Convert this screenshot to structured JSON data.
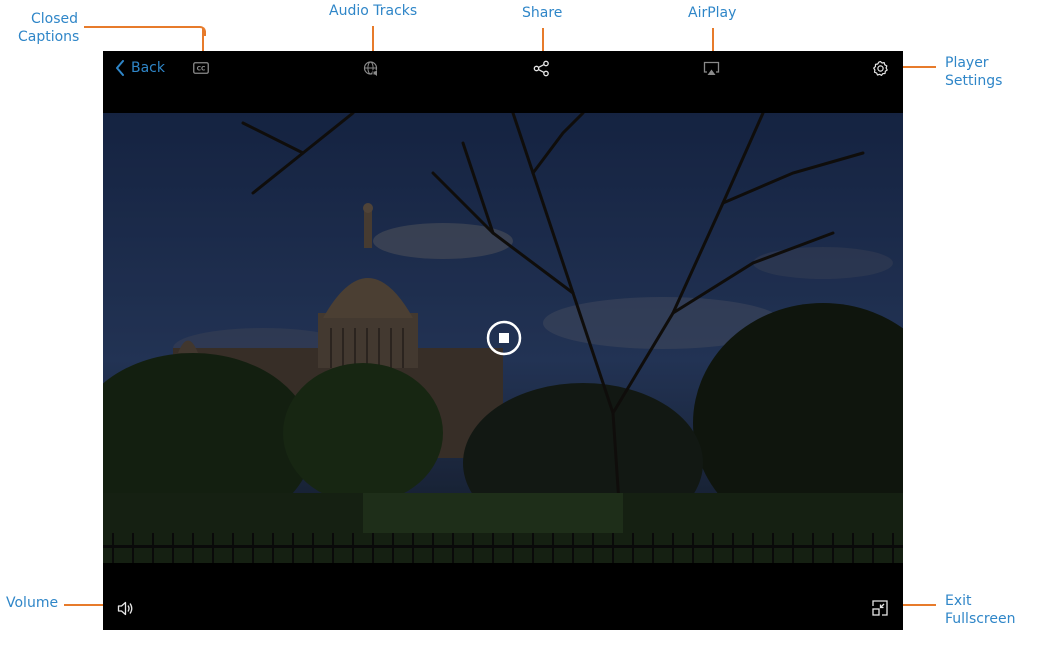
{
  "callouts": {
    "closed_captions": {
      "line1": "Closed",
      "line2": "Captions"
    },
    "audio_tracks": "Audio Tracks",
    "share": "Share",
    "airplay": "AirPlay",
    "player_settings": {
      "line1": "Player",
      "line2": "Settings"
    },
    "volume": "Volume",
    "exit_fullscreen": {
      "line1": "Exit",
      "line2": "Fullscreen"
    }
  },
  "player": {
    "back_label": "Back",
    "cc_label": "CC",
    "icons": {
      "back": "chevron-left-icon",
      "closed_captions": "cc-icon",
      "audio_tracks": "globe-audio-icon",
      "share": "share-icon",
      "airplay": "airplay-icon",
      "settings": "gear-icon",
      "stop": "stop-icon",
      "volume": "volume-icon",
      "exit_fullscreen": "exit-fullscreen-icon"
    }
  },
  "colors": {
    "accent": "#2f86c8",
    "callout_line": "#e77b2b",
    "player_bg": "#000000"
  }
}
